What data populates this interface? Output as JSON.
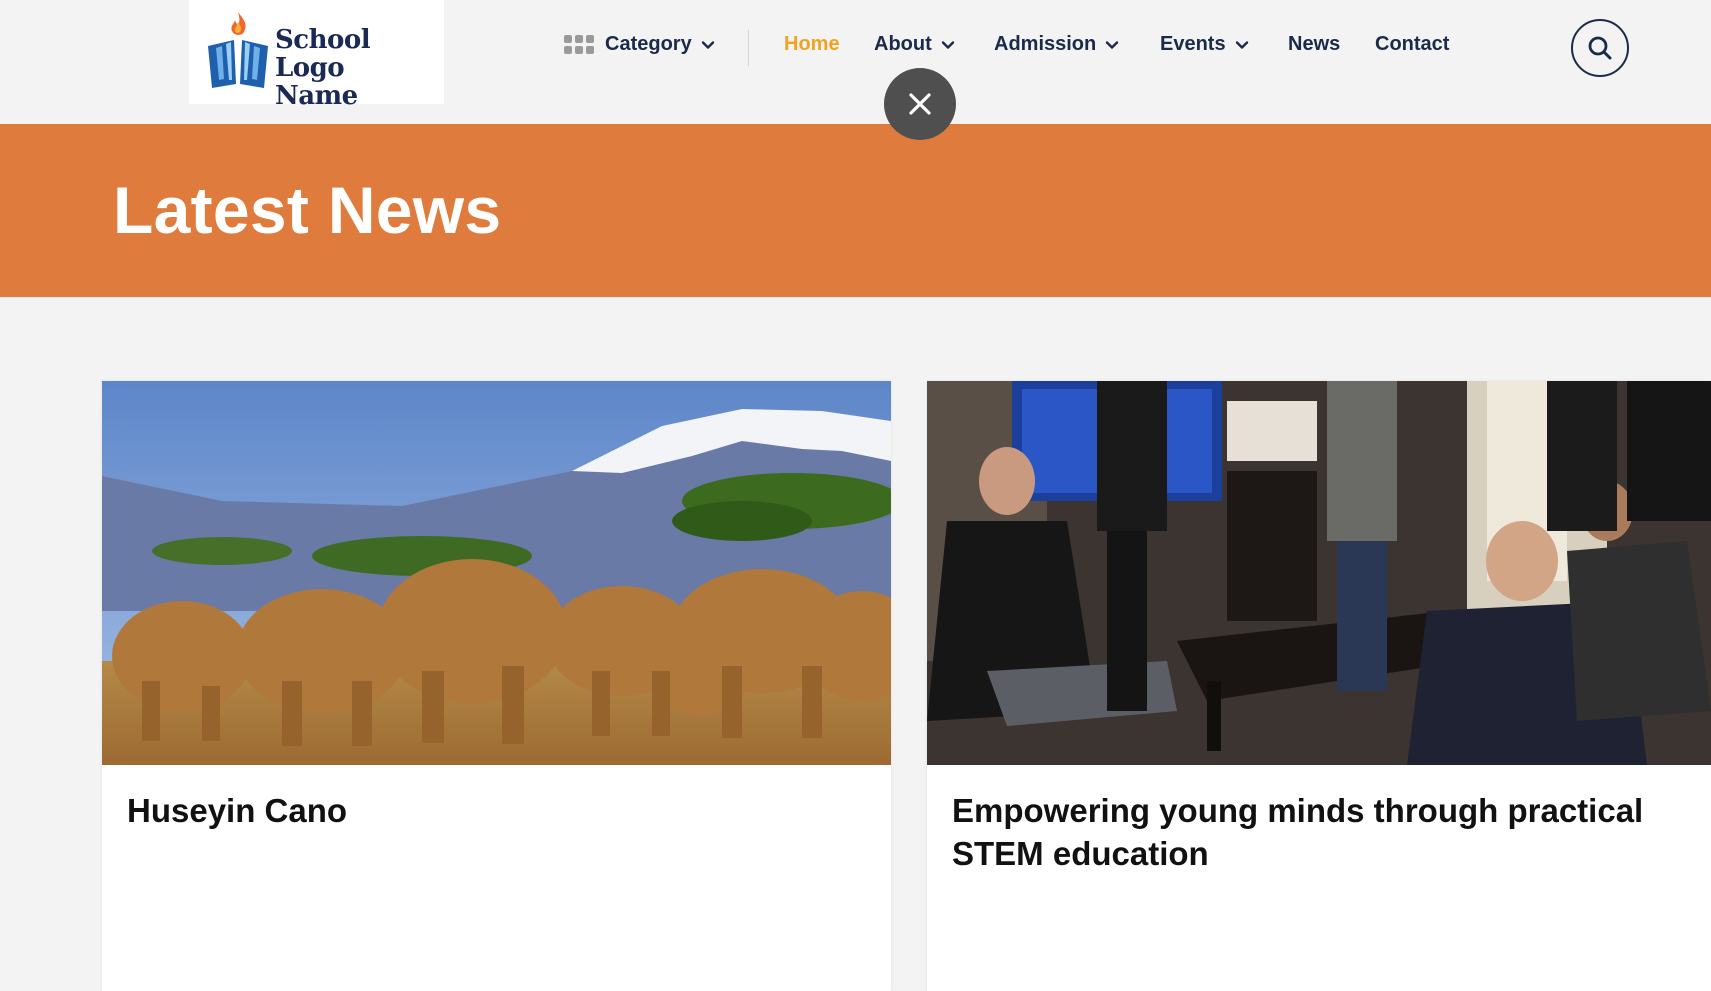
{
  "logo": {
    "line1": "School Logo",
    "line2": "Name",
    "alt_icon": "book-flame-icon"
  },
  "nav": {
    "category": "Category",
    "home": "Home",
    "about": "About",
    "admission": "Admission",
    "events": "Events",
    "news": "News",
    "contact": "Contact"
  },
  "icons": {
    "grid": "grid-icon",
    "search": "search-icon",
    "close": "close-icon",
    "chevron": "chevron-down-icon"
  },
  "colors": {
    "accent": "#f0a323",
    "banner": "#df7b3c",
    "nav_text": "#1c2a4a",
    "close_bg": "#4f4f4f"
  },
  "banner": {
    "title": "Latest News"
  },
  "cards": [
    {
      "title": "Huseyin Cano",
      "image": "elephants-savanna-photo"
    },
    {
      "title": "Empowering young minds through practical STEM education",
      "image": "people-meeting-room-photo"
    }
  ]
}
